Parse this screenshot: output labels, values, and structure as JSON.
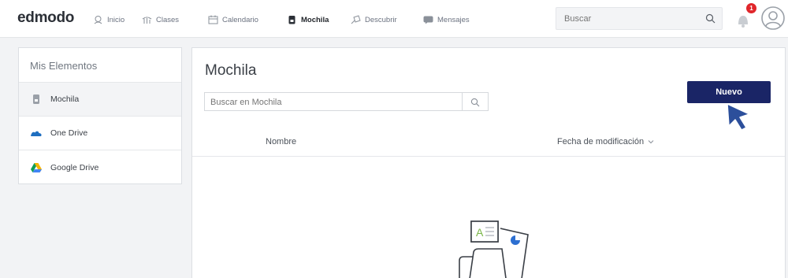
{
  "app": {
    "logo": "edmodo"
  },
  "nav": {
    "items": [
      {
        "label": "Inicio",
        "icon": "home-icon"
      },
      {
        "label": "Clases",
        "icon": "classes-icon"
      },
      {
        "label": "Calendario",
        "icon": "calendar-icon"
      },
      {
        "label": "Mochila",
        "icon": "backpack-icon",
        "active": true
      },
      {
        "label": "Descubrir",
        "icon": "discover-icon"
      },
      {
        "label": "Mensajes",
        "icon": "messages-icon"
      }
    ],
    "search_placeholder": "Buscar",
    "notification_count": "1"
  },
  "sidebar": {
    "title": "Mis Elementos",
    "items": [
      {
        "label": "Mochila",
        "icon": "backpack-icon",
        "active": true
      },
      {
        "label": "One Drive",
        "icon": "onedrive-icon"
      },
      {
        "label": "Google Drive",
        "icon": "google-drive-icon"
      }
    ]
  },
  "main": {
    "title": "Mochila",
    "new_button_label": "Nuevo",
    "search_placeholder": "Buscar en Mochila",
    "columns": {
      "name": "Nombre",
      "modified": "Fecha de modificación"
    }
  },
  "colors": {
    "primary_button": "#1a2566",
    "cursor": "#2c4f9b",
    "badge": "#e0262b"
  }
}
